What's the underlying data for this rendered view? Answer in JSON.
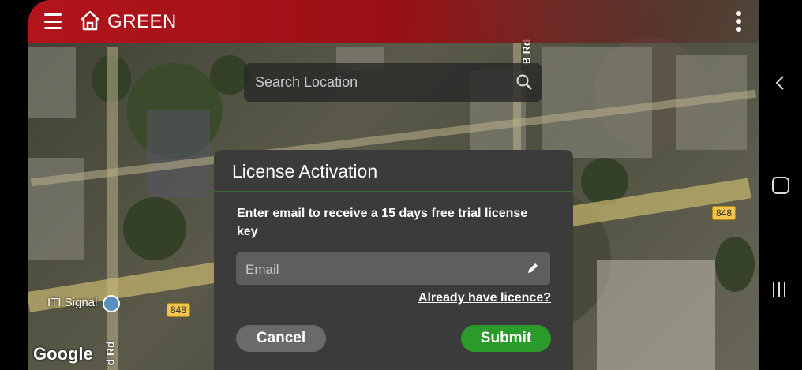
{
  "app": {
    "title": "GREEN"
  },
  "search": {
    "placeholder": "Search Location"
  },
  "map": {
    "road_label_top": "B Rd",
    "road_label_bottom": "d Rd",
    "highway_badge": "848",
    "poi_label": "ITI Signal",
    "attribution": "Google"
  },
  "dialog": {
    "title": "License Activation",
    "message": "Enter email to receive a 15 days free trial license key",
    "email_placeholder": "Email",
    "already_link": "Already have licence?",
    "cancel_label": "Cancel",
    "submit_label": "Submit"
  },
  "colors": {
    "topbar": "#b3141b",
    "submit": "#2a9a2a",
    "cancel": "#6a6a6a",
    "dialog_bg": "#3b3b3b"
  }
}
